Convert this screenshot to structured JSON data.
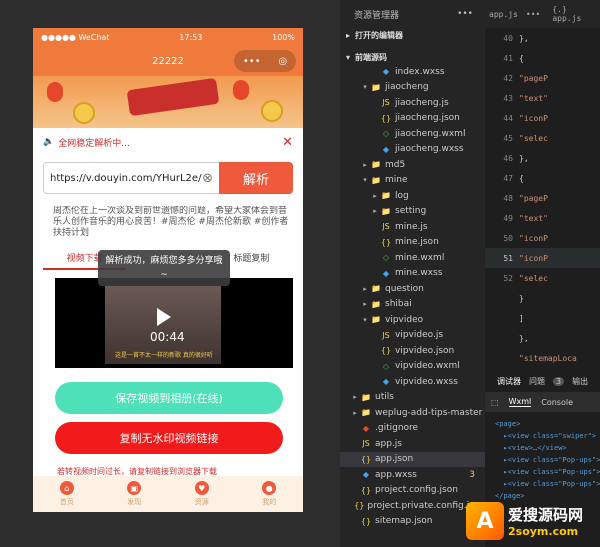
{
  "simulator": {
    "status": {
      "carrier": "●●●●● WeChat",
      "time": "17:53",
      "battery": "100%"
    },
    "nav_title": "22222",
    "capsule": {
      "more": "•••",
      "close": "◎"
    },
    "notice": "全网稳定解析中...",
    "input_value": "https://v.douyin.com/YHurL2e/",
    "parse_label": "解析",
    "description": "周杰伦在上一次谈及到前世遗憾的问题，希望大家体会到音乐人创作音乐的用心良苦！#周杰伦 #周杰伦新歌 #创作者扶持计划",
    "tabs": [
      "视频下载",
      "",
      "标题复制"
    ],
    "toast": "解析成功，麻烦您多多分享哦~",
    "video": {
      "time": "00:44",
      "caption": "这是一首不太一样的新歌 真的很好听"
    },
    "save_video": "保存视频到相册(在线)",
    "copy_link": "复制无水印视频链接",
    "hint": "若转视频时间过长，请复制链接到浏览器下载",
    "tabbar": [
      {
        "label": "首页",
        "icon": "home-icon"
      },
      {
        "label": "发现",
        "icon": "gift-icon"
      },
      {
        "label": "资源",
        "icon": "heart-icon"
      },
      {
        "label": "我的",
        "icon": "user-icon"
      }
    ]
  },
  "explorer": {
    "title": "资源管理器",
    "sections": [
      "打开的编辑器",
      "前端源码"
    ],
    "rows": [
      {
        "name": "index.wxss",
        "type": "wxss",
        "depth": 3,
        "arrow": ""
      },
      {
        "name": "jiaocheng",
        "type": "folder",
        "depth": 2,
        "arrow": "▾"
      },
      {
        "name": "jiaocheng.js",
        "type": "js",
        "depth": 3,
        "arrow": ""
      },
      {
        "name": "jiaocheng.json",
        "type": "json",
        "depth": 3,
        "arrow": ""
      },
      {
        "name": "jiaocheng.wxml",
        "type": "wxml",
        "depth": 3,
        "arrow": ""
      },
      {
        "name": "jiaocheng.wxss",
        "type": "wxss",
        "depth": 3,
        "arrow": ""
      },
      {
        "name": "md5",
        "type": "folder",
        "depth": 2,
        "arrow": "▸"
      },
      {
        "name": "mine",
        "type": "folder",
        "depth": 2,
        "arrow": "▾"
      },
      {
        "name": "log",
        "type": "folder",
        "depth": 3,
        "arrow": "▸"
      },
      {
        "name": "setting",
        "type": "folder",
        "depth": 3,
        "arrow": "▸"
      },
      {
        "name": "mine.js",
        "type": "js",
        "depth": 3,
        "arrow": ""
      },
      {
        "name": "mine.json",
        "type": "json",
        "depth": 3,
        "arrow": ""
      },
      {
        "name": "mine.wxml",
        "type": "wxml",
        "depth": 3,
        "arrow": ""
      },
      {
        "name": "mine.wxss",
        "type": "wxss",
        "depth": 3,
        "arrow": ""
      },
      {
        "name": "question",
        "type": "folder",
        "depth": 2,
        "arrow": "▸"
      },
      {
        "name": "shibai",
        "type": "folder",
        "depth": 2,
        "arrow": "▸"
      },
      {
        "name": "vipvideo",
        "type": "folder",
        "depth": 2,
        "arrow": "▾"
      },
      {
        "name": "vipvideo.js",
        "type": "js",
        "depth": 3,
        "arrow": ""
      },
      {
        "name": "vipvideo.json",
        "type": "json",
        "depth": 3,
        "arrow": ""
      },
      {
        "name": "vipvideo.wxml",
        "type": "wxml",
        "depth": 3,
        "arrow": ""
      },
      {
        "name": "vipvideo.wxss",
        "type": "wxss",
        "depth": 3,
        "arrow": ""
      },
      {
        "name": "utils",
        "type": "folder",
        "depth": 1,
        "arrow": "▸"
      },
      {
        "name": "weplug-add-tips-master",
        "type": "folder",
        "depth": 1,
        "arrow": "▸"
      },
      {
        "name": ".gitignore",
        "type": "git",
        "depth": 1,
        "arrow": ""
      },
      {
        "name": "app.js",
        "type": "js",
        "depth": 1,
        "arrow": ""
      },
      {
        "name": "app.json",
        "type": "json",
        "depth": 1,
        "arrow": "",
        "selected": true
      },
      {
        "name": "app.wxss",
        "type": "wxss",
        "depth": 1,
        "arrow": "",
        "badge": "3"
      },
      {
        "name": "project.config.json",
        "type": "json",
        "depth": 1,
        "arrow": ""
      },
      {
        "name": "project.private.config.json",
        "type": "json",
        "depth": 1,
        "arrow": ""
      },
      {
        "name": "sitemap.json",
        "type": "json",
        "depth": 1,
        "arrow": ""
      }
    ]
  },
  "editor": {
    "tab": "app.js",
    "breadcrumb": "{.} app.js",
    "lines": [
      {
        "num": "40",
        "code": "  },"
      },
      {
        "num": "41",
        "code": "  {"
      },
      {
        "num": "42",
        "code": "    \"pageP"
      },
      {
        "num": "43",
        "code": "    \"text\""
      },
      {
        "num": "44",
        "code": "    \"iconP"
      },
      {
        "num": "45",
        "code": "    \"selec"
      },
      {
        "num": "46",
        "code": "  },"
      },
      {
        "num": "47",
        "code": "  {"
      },
      {
        "num": "48",
        "code": "    \"pageP"
      },
      {
        "num": "49",
        "code": "    \"text\""
      },
      {
        "num": "50",
        "code": "    \"iconP"
      },
      {
        "num": "51",
        "code": "    \"iconP",
        "current": true
      },
      {
        "num": "52",
        "code": "    \"selec"
      },
      {
        "num": "",
        "code": "  }"
      },
      {
        "num": "",
        "code": "  ]"
      },
      {
        "num": "",
        "code": "},"
      },
      {
        "num": "",
        "code": "\"sitemapLoca"
      },
      {
        "num": "",
        "code": "}"
      }
    ]
  },
  "panel": {
    "tabs": [
      "调试器",
      "问题",
      "输出"
    ],
    "problem_count": "3",
    "subtabs": [
      "Wxml",
      "Console"
    ],
    "dom": [
      "<page>",
      "  ▸<view class=\"swiper\">",
      "  ▸<view>…</view>",
      "  ▸<view class=\"Pop-ups\">",
      "  ▸<view class=\"Pop-ups\">",
      "  ▸<view class=\"Pop-ups\">",
      "</page>"
    ]
  },
  "watermark": {
    "logo_letter": "A",
    "cn": "爱搜源码网",
    "en": "2soym.com"
  }
}
